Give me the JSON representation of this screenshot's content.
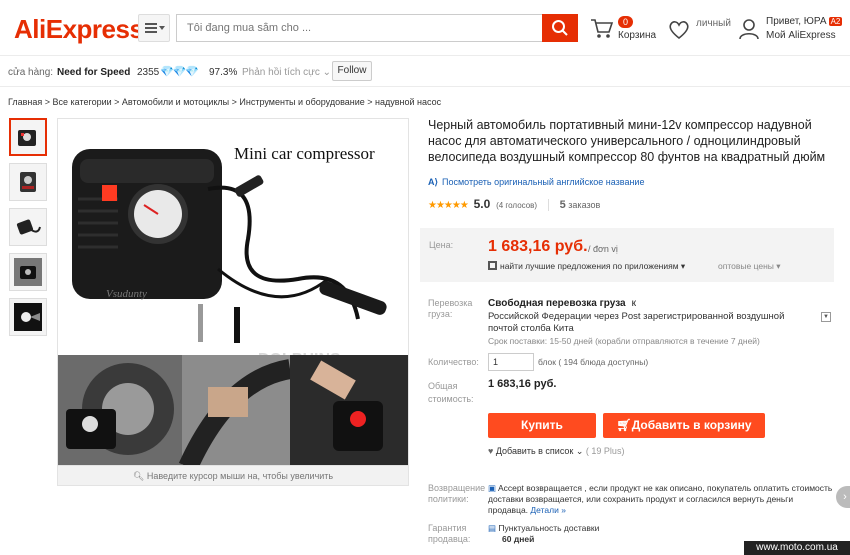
{
  "header": {
    "logo": "AliExpress",
    "search_placeholder": "Tôi đang mua sắm cho ...",
    "cart_count": "0",
    "cart_label": "Корзина",
    "wish_label": "личный",
    "greeting": "Привет, ЮРА",
    "greeting_tag": "A2",
    "account_label": "Мой AliExpress"
  },
  "store": {
    "label": "cửa hàng:",
    "name": "Need for Speed",
    "score": "2355",
    "diamonds": "💎💎💎",
    "positive": "97.3%",
    "feedback": "Phản hồi tích cực ⌄",
    "follow": "Follow"
  },
  "breadcrumb": "Главная > Все категории > Автомобили и мотоциклы > Инструменты и оборудование > надувной насос",
  "image": {
    "caption": "Mini car compressor",
    "watermark": "DOLPHINS",
    "zoom_hint": "Наведите курсор мыши на, чтобы увеличить"
  },
  "product": {
    "title": "Черный автомобиль портативный мини-12v компрессор надувной насос для автоматического универсального / одноцилиндровый велосипеда воздушный компрессор 80 фунтов на квадратный дюйм",
    "translate_link": "Посмотреть оригинальный английское название",
    "rating": "5.0",
    "votes": "(4 голосов)",
    "orders_count": "5",
    "orders_label": "заказов",
    "price_label": "Цена:",
    "price": "1 683,16 руб.",
    "price_unit": "/ đơn vị",
    "app_deals": "найти лучшие предложения по приложениям ▾",
    "wholesale": "оптовые цены ▾",
    "shipping_label": "Перевозка груза:",
    "shipping_title": "Свободная перевозка груза",
    "shipping_k": "к",
    "shipping_desc": "Российской Федерации через Post зарегистрированной воздушной почтой столба Кита",
    "shipping_time": "Срок поставки: 15-50 дней (корабли отправляются в течение 7 дней)",
    "qty_label": "Количество:",
    "qty_value": "1",
    "qty_note": "блок ( 194 блюда доступны)",
    "total_label": "Общая стоимость:",
    "total_value": "1 683,16 руб.",
    "buy_label": "Купить",
    "addcart_label": "Добавить в корзину",
    "wishlist_label": "Добавить в список ⌄",
    "wishlist_count": "( 19 Plus)",
    "returns_label": "Возвращение политики:",
    "returns_text": "Accept возвращается , если продукт не как описано, покупатель оплатить стоимость доставки возвращается, или сохранить продукт и согласился вернуть деньги продавца.",
    "returns_link": "Детали »",
    "guarantee_label": "Гарантия продавца:",
    "guarantee_line1": "Пунктуальность доставки",
    "guarantee_line2": "60 дней"
  },
  "site_watermark": "www.moto.com.ua",
  "colors": {
    "brand": "#e62e04",
    "button": "#ff4b1f",
    "link": "#1a60b5",
    "star": "#ff9a00"
  }
}
